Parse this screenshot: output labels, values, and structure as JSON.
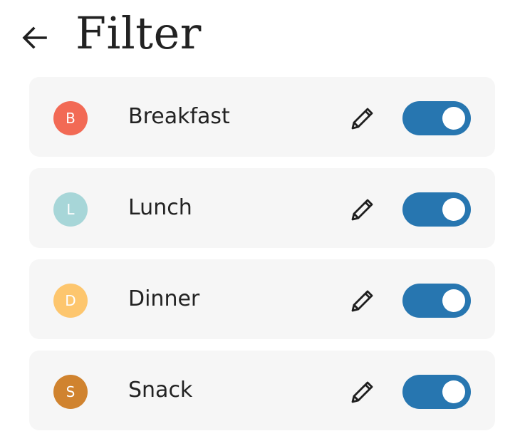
{
  "header": {
    "title": "Filter",
    "back_icon": "arrow-left-icon"
  },
  "categories": [
    {
      "initial": "B",
      "label": "Breakfast",
      "color": "#f26a55",
      "enabled": true,
      "edit_icon": "pencil-icon"
    },
    {
      "initial": "L",
      "label": "Lunch",
      "color": "#a7d6d8",
      "enabled": true,
      "edit_icon": "pencil-icon"
    },
    {
      "initial": "D",
      "label": "Dinner",
      "color": "#fdc66e",
      "enabled": true,
      "edit_icon": "pencil-icon"
    },
    {
      "initial": "S",
      "label": "Snack",
      "color": "#d0832f",
      "enabled": true,
      "edit_icon": "pencil-icon"
    }
  ],
  "colors": {
    "toggle_on": "#2776b0",
    "row_background": "#f6f6f6"
  }
}
